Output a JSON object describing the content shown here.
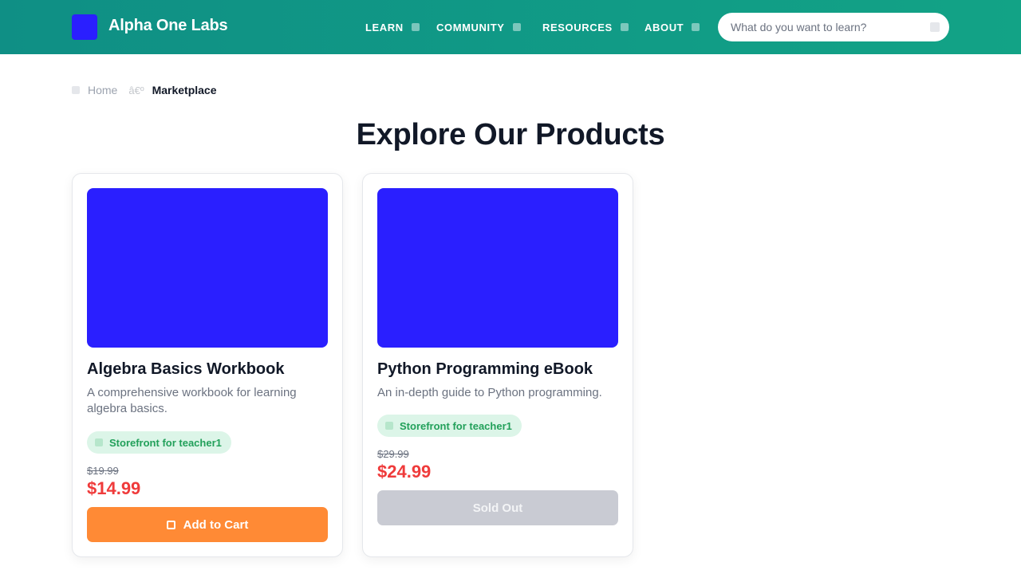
{
  "header": {
    "brand": "Alpha One Labs",
    "nav": [
      {
        "label": "LEARN"
      },
      {
        "label": "COMMUNITY"
      },
      {
        "label": "RESOURCES"
      },
      {
        "label": "ABOUT"
      }
    ],
    "search": {
      "placeholder": "What do you want to learn?",
      "value": ""
    }
  },
  "breadcrumb": {
    "home": "Home",
    "separator": "â€º",
    "current": "Marketplace"
  },
  "page": {
    "title": "Explore Our Products"
  },
  "products": [
    {
      "title": "Algebra Basics Workbook",
      "description": "A comprehensive workbook for learning algebra basics.",
      "storefront": "Storefront for teacher1",
      "old_price": "$19.99",
      "price": "$14.99",
      "button": "Add to Cart",
      "status": "available"
    },
    {
      "title": "Python Programming eBook",
      "description": "An in-depth guide to Python programming.",
      "storefront": "Storefront for teacher1",
      "old_price": "$29.99",
      "price": "$24.99",
      "button": "Sold Out",
      "status": "sold-out"
    }
  ],
  "colors": {
    "header_start": "#0f8f85",
    "header_end": "#12a386",
    "product_image": "#2a1fff",
    "price": "#ef3b3b",
    "cart_button": "#ff8a35",
    "sold_out_button": "#c9cbd3",
    "badge_bg": "#dcf5e8",
    "badge_text": "#22a05a"
  },
  "icons": {
    "logo": "logo-square-icon",
    "nav_dropdown": "dropdown-square-icon",
    "search": "search-icon",
    "breadcrumb_home": "home-icon",
    "storefront": "store-icon",
    "cart": "cart-icon"
  }
}
